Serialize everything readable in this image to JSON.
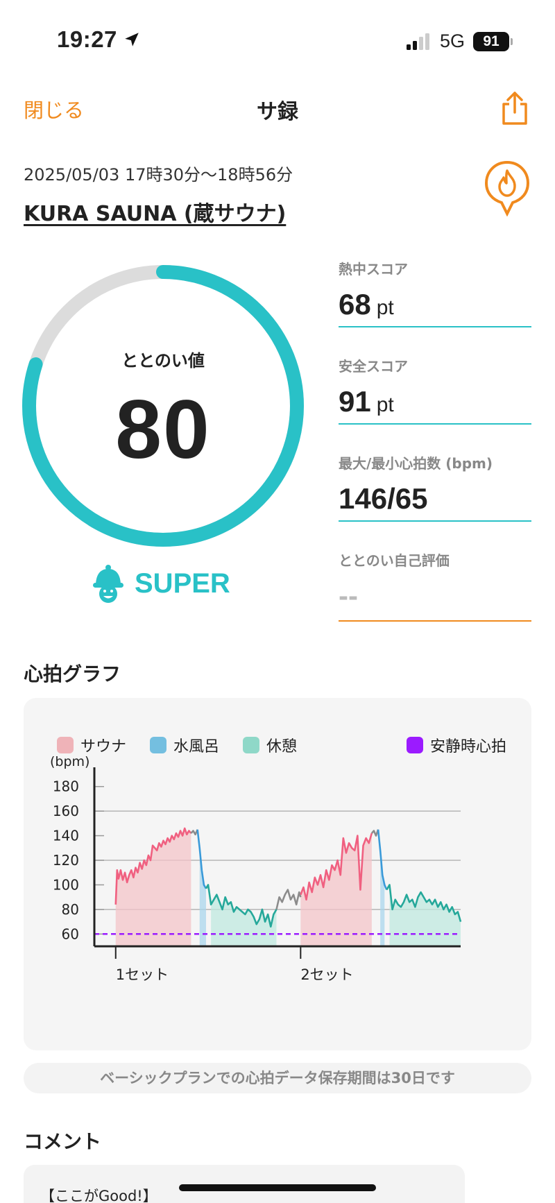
{
  "status": {
    "time": "19:27",
    "network": "5G",
    "battery": "91"
  },
  "nav": {
    "close_label": "閉じる",
    "title": "サ録"
  },
  "session": {
    "datetime": "2025/05/03 17時30分〜18時56分",
    "place": "KURA SAUNA (蔵サウナ)"
  },
  "totonoi": {
    "label": "ととのい値",
    "value": "80",
    "max": 100,
    "rank": "SUPER"
  },
  "metrics": [
    {
      "label": "熱中スコア",
      "value": "68",
      "unit": "pt"
    },
    {
      "label": "安全スコア",
      "value": "91",
      "unit": "pt"
    },
    {
      "label": "最大/最小心拍数 (bpm)",
      "value": "146/65",
      "unit": ""
    },
    {
      "label": "ととのい自己評価",
      "value": "--",
      "unit": ""
    }
  ],
  "colors": {
    "accent": "#f08a1e",
    "teal": "#29c1c7",
    "sauna": "#f06080",
    "water": "#3a9ad9",
    "rest": "#25a89a",
    "resting": "#9b1bff"
  },
  "heart_graph": {
    "section_title": "心拍グラフ"
  },
  "chart_data": {
    "type": "line",
    "ylabel": "(bpm)",
    "ylim": [
      50,
      190
    ],
    "yticks": [
      180,
      160,
      140,
      120,
      100,
      80,
      60
    ],
    "legend": [
      {
        "name": "サウナ",
        "color": "#efb3b8"
      },
      {
        "name": "水風呂",
        "color": "#74bfe0"
      },
      {
        "name": "休憩",
        "color": "#8fd8c8"
      },
      {
        "name": "安静時心拍",
        "color": "#9b1bff"
      }
    ],
    "x_markers": [
      {
        "t": 0,
        "label": "1セット"
      },
      {
        "t": 52,
        "label": "2セット"
      }
    ],
    "resting_hr": 60,
    "series": [
      {
        "phase": "sauna",
        "x": [
          0,
          0.4,
          0.8,
          1.4,
          2,
          2.6,
          3.2,
          3.8,
          4.4,
          5,
          5.6,
          6.2,
          6.8,
          7.4,
          8,
          8.6,
          9.2,
          9.8,
          10.4,
          11,
          11.6,
          12.2,
          12.8,
          13.4,
          14,
          14.6,
          15.2,
          15.8,
          16.4,
          17,
          17.6,
          18.2,
          18.8,
          19.4,
          20,
          20.6,
          21.2
        ],
        "y": [
          84,
          112,
          105,
          112,
          104,
          110,
          102,
          108,
          112,
          106,
          114,
          110,
          118,
          113,
          120,
          116,
          124,
          120,
          132,
          130,
          128,
          134,
          131,
          136,
          133,
          138,
          135,
          140,
          137,
          142,
          139,
          144,
          140,
          146,
          141,
          144,
          142
        ]
      },
      {
        "phase": "transition",
        "x": [
          21.2,
          21.8,
          22.4,
          23
        ],
        "y": [
          142,
          144,
          141,
          145
        ]
      },
      {
        "phase": "water",
        "x": [
          23,
          23.6,
          24.2,
          24.8,
          25.4
        ],
        "y": [
          145,
          130,
          112,
          100,
          97
        ]
      },
      {
        "phase": "rest",
        "x": [
          25.4,
          26,
          26.8,
          27.6,
          28.4,
          29.2,
          30,
          30.8,
          31.6,
          32.4,
          33.2,
          34,
          34.8,
          35.6,
          36.4,
          37.2,
          38,
          38.8,
          39.6,
          40.4,
          41.2,
          42,
          42.8,
          43.6,
          44.4,
          45.2
        ],
        "y": [
          97,
          100,
          84,
          88,
          92,
          86,
          80,
          90,
          84,
          86,
          78,
          82,
          80,
          78,
          76,
          80,
          78,
          74,
          68,
          72,
          80,
          70,
          76,
          66,
          76,
          80
        ]
      },
      {
        "phase": "transition",
        "x": [
          45.2,
          46,
          46.8,
          47.6,
          48.4,
          49.2,
          50,
          50.8,
          51.6,
          52
        ],
        "y": [
          80,
          90,
          86,
          92,
          96,
          88,
          92,
          84,
          94,
          90
        ]
      },
      {
        "phase": "sauna",
        "x": [
          52,
          52.8,
          53.6,
          54.4,
          55.2,
          56,
          56.8,
          57.6,
          58.4,
          59.2,
          60,
          60.8,
          61.6,
          62.4,
          63.2,
          64,
          64.8,
          65.6,
          66.4,
          67.2,
          68,
          68.8,
          69.6,
          70.4,
          71.2,
          72
        ],
        "y": [
          92,
          98,
          88,
          102,
          94,
          106,
          100,
          108,
          98,
          112,
          104,
          116,
          112,
          120,
          108,
          138,
          126,
          134,
          130,
          128,
          140,
          96,
          132,
          138,
          134,
          142
        ]
      },
      {
        "phase": "transition",
        "x": [
          72,
          72.6,
          73.2,
          73.8
        ],
        "y": [
          142,
          144,
          140,
          145
        ]
      },
      {
        "phase": "water",
        "x": [
          73.8,
          74.4,
          75,
          75.6,
          76.2
        ],
        "y": [
          145,
          128,
          108,
          100,
          96
        ]
      },
      {
        "phase": "rest",
        "x": [
          76.2,
          77,
          77.8,
          78.6,
          79.4,
          80.2,
          81,
          81.8,
          82.6,
          83.4,
          84.2,
          85,
          85.8,
          86.6,
          87.4,
          88.2,
          89,
          89.8,
          90.6,
          91.4,
          92.2,
          93,
          93.8,
          94.6,
          95.4,
          96.2,
          97
        ],
        "y": [
          96,
          100,
          80,
          88,
          84,
          82,
          86,
          92,
          86,
          88,
          82,
          90,
          94,
          90,
          86,
          88,
          84,
          88,
          82,
          86,
          80,
          84,
          78,
          82,
          76,
          78,
          70
        ]
      }
    ],
    "phases": [
      {
        "type": "sauna",
        "x0": 0,
        "x1": 21.5
      },
      {
        "type": "water",
        "x0": 23.5,
        "x1": 25.4
      },
      {
        "type": "rest",
        "x0": 26.5,
        "x1": 45.2
      },
      {
        "type": "sauna",
        "x0": 52,
        "x1": 72.2
      },
      {
        "type": "water",
        "x0": 74.2,
        "x1": 76
      },
      {
        "type": "rest",
        "x0": 77,
        "x1": 97
      }
    ],
    "xlim": [
      -6,
      97
    ]
  },
  "notice": "ベーシックプランでの心拍データ保存期間は30日です",
  "comment": {
    "section_title": "コメント",
    "first_line": "【ここがGood!】"
  }
}
